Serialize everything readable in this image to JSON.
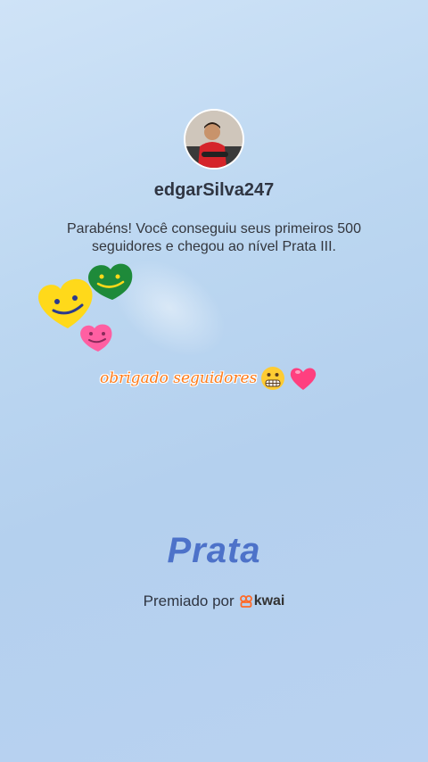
{
  "user": {
    "username": "edgarSilva247",
    "avatar_icon": "profile-photo"
  },
  "message": "Parabéns! Você conseguiu seus primeiros 500 seguidores e chegou ao nível Prata III.",
  "sticker": {
    "caption": "obrigado seguidores",
    "emojis": [
      "grimacing-face-icon",
      "heart-icon"
    ],
    "hearts": [
      "yellow-smiley-heart",
      "green-smiley-heart",
      "pink-smiley-heart"
    ]
  },
  "tier": "Prata",
  "awarded_by": {
    "label": "Premiado por",
    "brand": "kwai",
    "brand_color": "#ff6a28"
  },
  "colors": {
    "tier": "#4d72c9",
    "caption": "#ff7b1a"
  }
}
